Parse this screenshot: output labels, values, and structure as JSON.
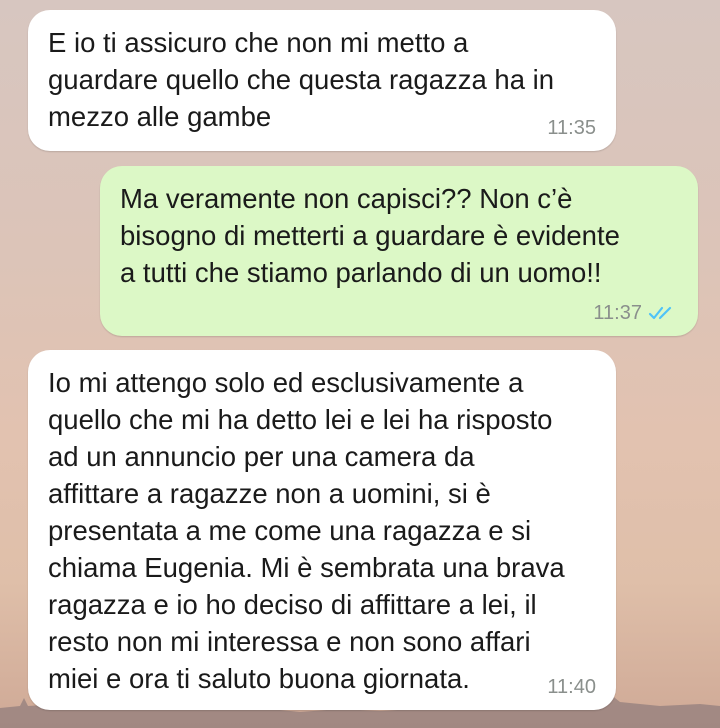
{
  "messages": [
    {
      "direction": "incoming",
      "text": "E io ti assicuro che non mi metto a\nguardare quello che questa ragazza ha in\nmezzo alle gambe",
      "time": "11:35"
    },
    {
      "direction": "outgoing",
      "text": "Ma veramente non capisci?? Non c’è\nbisogno di metterti a guardare è evidente\na tutti che stiamo parlando di un uomo!!",
      "time": "11:37",
      "status_icon": "double-check-read-icon",
      "status_color": "#4fc3f7"
    },
    {
      "direction": "incoming",
      "text": "Io mi attengo solo ed esclusivamente a\nquello che mi ha detto lei e lei ha risposto\nad un annuncio per una camera da\naffittare a ragazze non a uomini, si è\npresentata a me come una ragazza e si\nchiama Eugenia. Mi è sembrata una brava\nragazza e io ho deciso di affittare a lei, il\nresto non mi interessa e non sono affari\nmiei e ora ti saluto buona giornata.",
      "time": "11:40"
    }
  ],
  "colors": {
    "incoming_bubble": "#ffffff",
    "outgoing_bubble": "#dcf8c6",
    "timestamp": "#8a8f8c"
  }
}
